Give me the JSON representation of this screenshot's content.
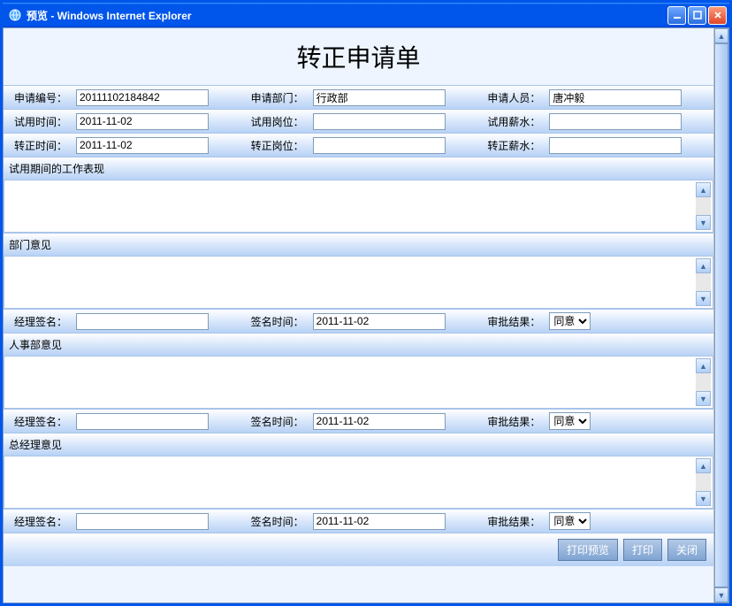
{
  "window": {
    "title": "预览 - Windows Internet Explorer"
  },
  "page": {
    "title": "转正申请单"
  },
  "fields": {
    "apply_no_label": "申请编号：",
    "apply_no_value": "20111102184842",
    "apply_dept_label": "申请部门：",
    "apply_dept_value": "行政部",
    "apply_person_label": "申请人员：",
    "apply_person_value": "唐冲毅",
    "trial_time_label": "试用时间：",
    "trial_time_value": "2011-11-02",
    "trial_post_label": "试用岗位：",
    "trial_post_value": "",
    "trial_salary_label": "试用薪水：",
    "trial_salary_value": "",
    "reg_time_label": "转正时间：",
    "reg_time_value": "2011-11-02",
    "reg_post_label": "转正岗位：",
    "reg_post_value": "",
    "reg_salary_label": "转正薪水：",
    "reg_salary_value": ""
  },
  "sections": {
    "trial_perf": "试用期间的工作表现",
    "dept_opinion": "部门意见",
    "hr_opinion": "人事部意见",
    "gm_opinion": "总经理意见"
  },
  "sign": {
    "mgr_sign_label": "经理签名：",
    "mgr_sign_value": "",
    "sign_time_label": "签名时间：",
    "sign_time_value": "2011-11-02",
    "approve_result_label": "审批结果：",
    "approve_result_value": "同意"
  },
  "buttons": {
    "print_preview": "打印预览",
    "print": "打印",
    "close": "关闭"
  }
}
